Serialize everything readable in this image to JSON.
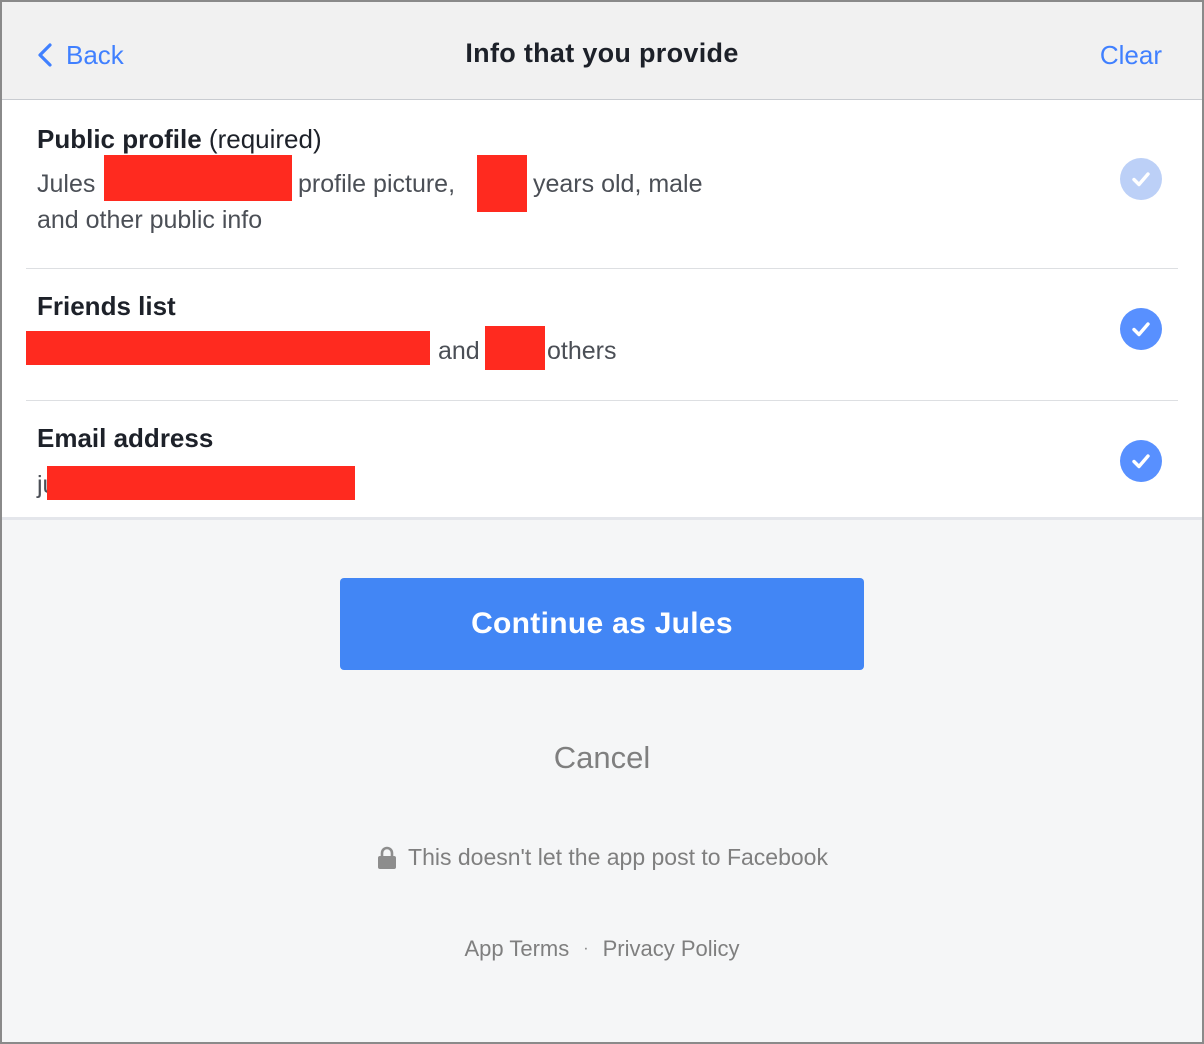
{
  "header": {
    "back_label": "Back",
    "title": "Info that you provide",
    "clear_label": "Clear"
  },
  "permissions": [
    {
      "title": "Public profile",
      "title_suffix": "(required)",
      "desc_parts": [
        "Jules",
        "profile picture,",
        "years old, male"
      ],
      "desc_line2": "and other public info",
      "checked": true,
      "disabled": true
    },
    {
      "title": "Friends list",
      "desc_parts": [
        "and",
        "others"
      ],
      "checked": true,
      "disabled": false
    },
    {
      "title": "Email address",
      "desc_parts": [
        "ju"
      ],
      "checked": true,
      "disabled": false
    }
  ],
  "actions": {
    "continue_label": "Continue as Jules",
    "cancel_label": "Cancel"
  },
  "notice": {
    "icon": "lock-icon",
    "text": "This doesn't let the app post to Facebook"
  },
  "footer": {
    "app_terms": "App Terms",
    "separator": "·",
    "privacy_policy": "Privacy Policy"
  },
  "colors": {
    "accent": "#4080ff",
    "button": "#4286f5",
    "check_active": "#5890ff",
    "check_disabled": "#bcd0f7",
    "redaction": "#ff2a1f"
  }
}
